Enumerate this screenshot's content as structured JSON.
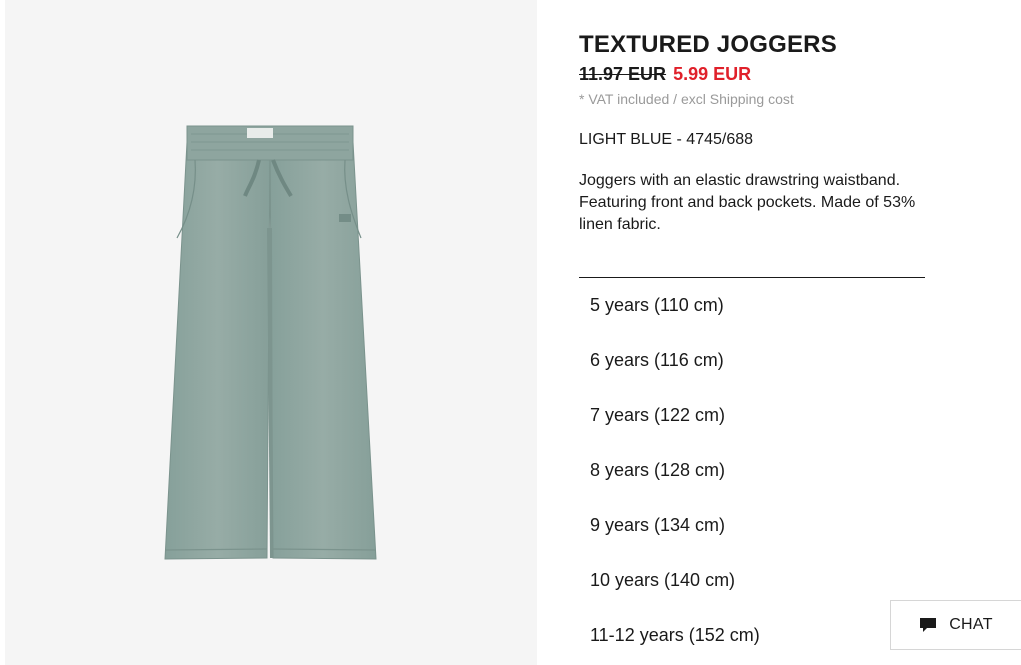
{
  "product": {
    "title": "TEXTURED JOGGERS",
    "old_price": "11.97 EUR",
    "new_price": "5.99 EUR",
    "vat_note": "* VAT included / excl Shipping cost",
    "color_ref": "LIGHT BLUE - 4745/688",
    "description": "Joggers with an elastic drawstring waistband. Featuring front and back pockets. Made of 53% linen fabric."
  },
  "sizes": [
    "5 years (110 cm)",
    "6 years (116 cm)",
    "7 years (122 cm)",
    "8 years (128 cm)",
    "9 years (134 cm)",
    "10 years (140 cm)",
    "11-12 years (152 cm)"
  ],
  "chat": {
    "label": "CHAT",
    "icon": "chat-bubble-icon"
  },
  "colors": {
    "sale_price": "#e0202a",
    "image_background": "#f5f5f5",
    "fabric": "#8fa5a0"
  }
}
